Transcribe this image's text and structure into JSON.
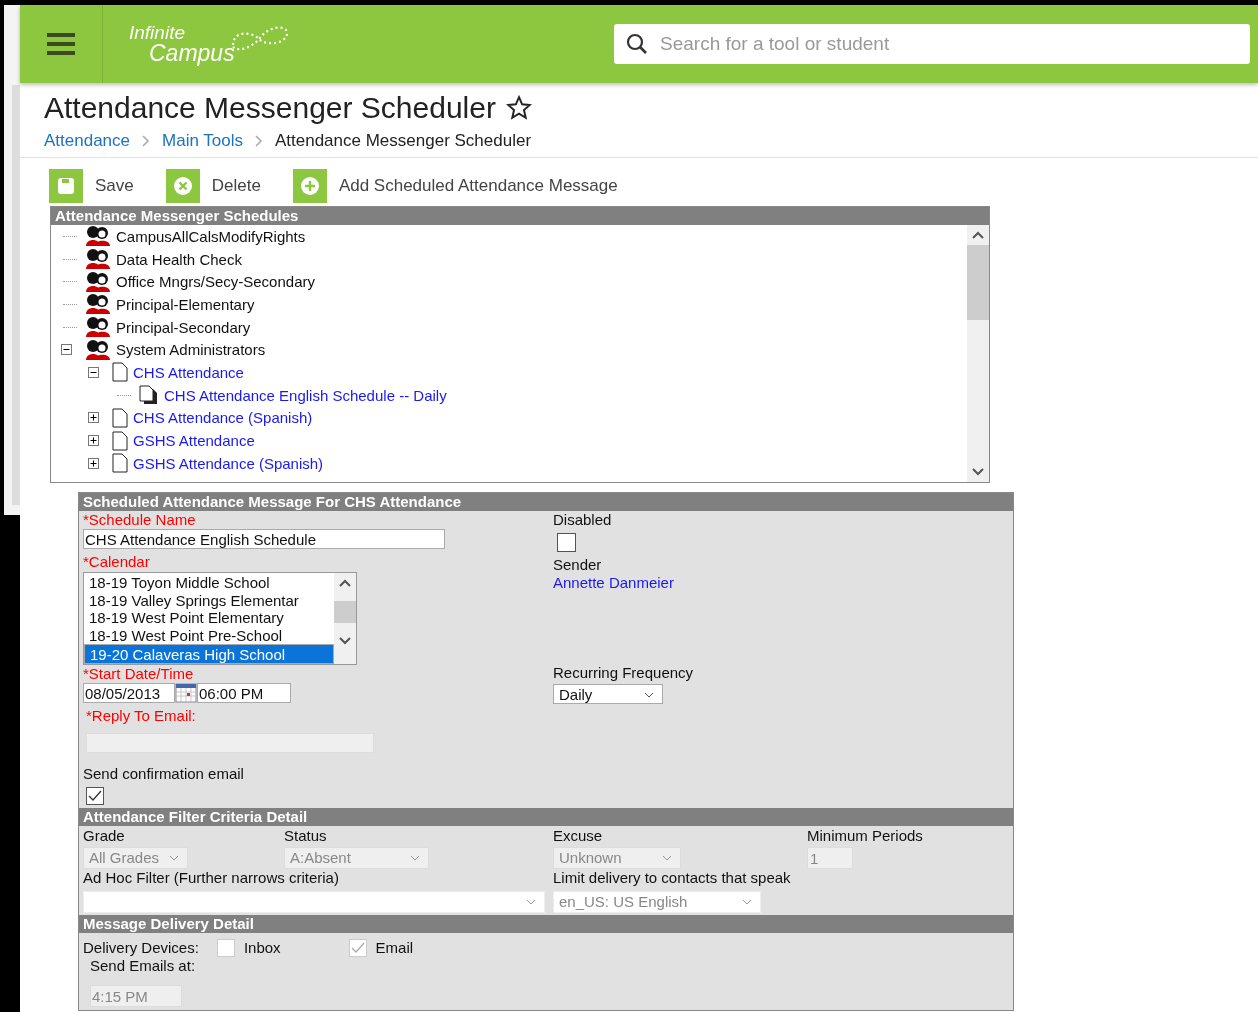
{
  "header": {
    "logo_line_1": "Infinite",
    "logo_line_2": "Campus",
    "search": {
      "placeholder": "Search for a tool or student"
    }
  },
  "page": {
    "title": "Attendance Messenger Scheduler",
    "favorite": false,
    "breadcrumbs": [
      {
        "label": "Attendance",
        "kind": "link"
      },
      {
        "label": "Main Tools",
        "kind": "link"
      },
      {
        "label": "Attendance Messenger Scheduler",
        "kind": "current"
      }
    ]
  },
  "toolbar": [
    {
      "kind": "save",
      "label": "Save"
    },
    {
      "kind": "delete",
      "label": "Delete"
    },
    {
      "kind": "add",
      "label": "Add Scheduled Attendance Message"
    }
  ],
  "schedules": {
    "title": "Attendance Messenger Schedules",
    "items": [
      {
        "kind": "group",
        "label": "CampusAllCalsModifyRights"
      },
      {
        "kind": "group",
        "label": "Data Health Check"
      },
      {
        "kind": "group",
        "label": "Office Mngrs/Secy-Secondary"
      },
      {
        "kind": "group",
        "label": "Principal-Elementary"
      },
      {
        "kind": "group",
        "label": "Principal-Secondary"
      },
      {
        "kind": "group",
        "label": "System Administrators",
        "expanded": true,
        "children": [
          {
            "kind": "message",
            "label": "CHS Attendance",
            "expanded": true,
            "children": [
              {
                "kind": "schedule",
                "label": "CHS Attendance English Schedule -- Daily"
              }
            ]
          },
          {
            "kind": "message",
            "label": "CHS Attendance (Spanish)",
            "expanded": false
          },
          {
            "kind": "message",
            "label": "GSHS Attendance",
            "expanded": false
          },
          {
            "kind": "message",
            "label": "GSHS Attendance (Spanish)",
            "expanded": false
          }
        ]
      }
    ]
  },
  "message": {
    "title": "Scheduled Attendance Message For CHS Attendance",
    "schedule_name": {
      "label": "*Schedule Name",
      "value": "CHS Attendance English Schedule"
    },
    "disabled": {
      "label": "Disabled",
      "checked": false
    },
    "calendar": {
      "label": "*Calendar",
      "options": [
        {
          "label": "18-19 Toyon Middle School",
          "selected": false
        },
        {
          "label": "18-19 Valley Springs Elementar",
          "selected": false
        },
        {
          "label": "18-19 West Point Elementary",
          "selected": false
        },
        {
          "label": "18-19 West Point Pre-School",
          "selected": false
        },
        {
          "label": "19-20 Calaveras High School",
          "selected": true
        }
      ]
    },
    "sender": {
      "label": "Sender",
      "value": "Annette Danmeier"
    },
    "start": {
      "label": "*Start Date/Time",
      "date": "08/05/2013",
      "time": "06:00 PM"
    },
    "frequency": {
      "label": "Recurring Frequency",
      "value": "Daily"
    },
    "reply_to": {
      "label": "*Reply To Email:"
    },
    "confirmation": {
      "label": "Send confirmation email",
      "checked": true
    }
  },
  "filter": {
    "title": "Attendance Filter Criteria Detail",
    "grade": {
      "label": "Grade",
      "value": "All Grades"
    },
    "status": {
      "label": "Status",
      "value": "A:Absent"
    },
    "excuse": {
      "label": "Excuse",
      "value": "Unknown"
    },
    "minimum_periods": {
      "label": "Minimum Periods",
      "value": "1"
    },
    "ad_hoc": {
      "label": "Ad Hoc Filter (Further narrows criteria)"
    },
    "language": {
      "label": "Limit delivery to contacts that speak",
      "value": "en_US: US English"
    }
  },
  "delivery": {
    "title": "Message Delivery Detail",
    "devices_label": "Delivery Devices:",
    "devices": [
      {
        "label": "Inbox",
        "checked": false
      },
      {
        "label": "Email",
        "checked": true
      }
    ],
    "send_at": {
      "label": "Send Emails at:",
      "value": "4:15 PM"
    }
  }
}
